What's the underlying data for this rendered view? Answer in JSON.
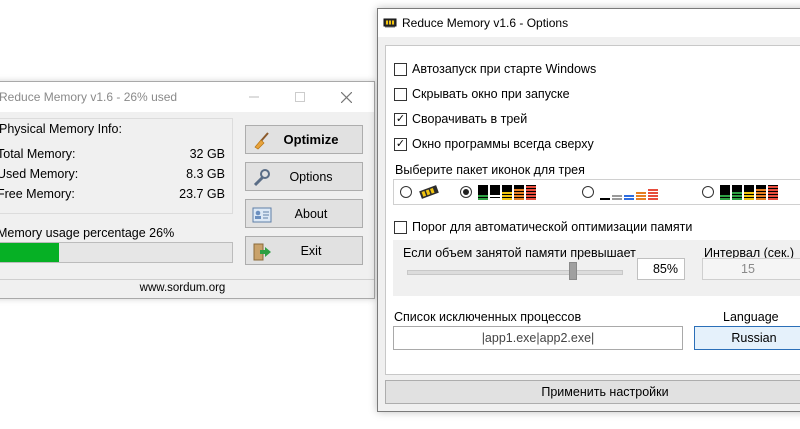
{
  "main_window": {
    "title": "Reduce Memory v1.6 - 26% used",
    "group_title": "Physical Memory Info:",
    "rows": [
      {
        "label": "Total Memory:",
        "value": "32 GB"
      },
      {
        "label": "Used Memory:",
        "value": "8.3 GB"
      },
      {
        "label": "Free Memory:",
        "value": "23.7 GB"
      }
    ],
    "usage_label": "Memory usage percentage 26%",
    "usage_fraction": 0.26,
    "buttons": {
      "optimize": "Optimize",
      "options": "Options",
      "about": "About",
      "exit": "Exit"
    },
    "status": "www.sordum.org",
    "progress_color": "#06b025"
  },
  "options_window": {
    "title": "Reduce Memory v1.6 - Options",
    "checkboxes": [
      {
        "label": "Автозапуск при старте Windows",
        "checked": false
      },
      {
        "label": "Скрывать окно при запуске",
        "checked": false
      },
      {
        "label": "Сворачивать в трей",
        "checked": true
      },
      {
        "label": "Окно программы всегда сверху",
        "checked": true
      }
    ],
    "icon_pack_label": "Выберите пакет иконок для трея",
    "auto_optimize_label": "Порог для автоматической оптимизации памяти",
    "auto_optimize_checked": false,
    "threshold_label": "Если объем занятой памяти превышает",
    "threshold_value": "85%",
    "interval_label": "Интервал (сек.)",
    "interval_value": "15",
    "excluded_label": "Список исключенных процессов",
    "excluded_value": "|app1.exe|app2.exe|",
    "language_label": "Language",
    "language_value": "Russian",
    "apply_label": "Применить настройки",
    "accent_color": "#2b6fb8"
  }
}
